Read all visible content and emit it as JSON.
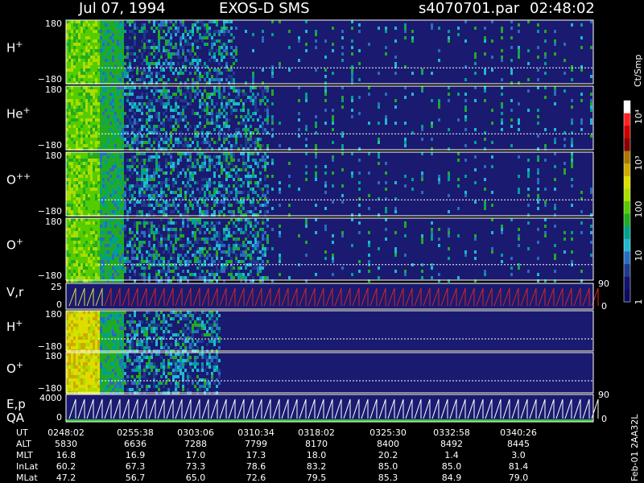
{
  "header": {
    "date": "Jul 07, 1994",
    "instrument": "EXOS-D SMS",
    "file": "s4070701.par",
    "time": "02:48:02"
  },
  "chart_data": {
    "type": "heatmap",
    "panels": [
      {
        "id": "h1",
        "label": "H",
        "sup": "+",
        "ytop": "180",
        "ybot": "−180",
        "ylim": [
          -180,
          180
        ],
        "kind": "spec",
        "rightlabel": ""
      },
      {
        "id": "he",
        "label": "He",
        "sup": "+",
        "ytop": "180",
        "ybot": "−180",
        "ylim": [
          -180,
          180
        ],
        "kind": "spec",
        "rightlabel": ""
      },
      {
        "id": "opp",
        "label": "O",
        "sup": "++",
        "ytop": "180",
        "ybot": "−180",
        "ylim": [
          -180,
          180
        ],
        "kind": "spec",
        "rightlabel": ""
      },
      {
        "id": "o1",
        "label": "O",
        "sup": "+",
        "ytop": "180",
        "ybot": "−180",
        "ylim": [
          -180,
          180
        ],
        "kind": "spec",
        "rightlabel": ""
      },
      {
        "id": "vr",
        "label": "V,r",
        "sup": "",
        "ytop": "25",
        "ybot": "0",
        "ylim": [
          0,
          25
        ],
        "kind": "saw",
        "rightlabel": "90",
        "rightlabel2": "0"
      },
      {
        "id": "h2",
        "label": "H",
        "sup": "+",
        "ytop": "180",
        "ybot": "−180",
        "ylim": [
          -180,
          180
        ],
        "kind": "spec2",
        "rightlabel": ""
      },
      {
        "id": "o2",
        "label": "O",
        "sup": "+",
        "ytop": "180",
        "ybot": "−180",
        "ylim": [
          -180,
          180
        ],
        "kind": "spec2",
        "rightlabel": ""
      },
      {
        "id": "ep",
        "label": "E,p",
        "sup": "",
        "label2": "QA",
        "ytop": "4000",
        "ybot": "0",
        "ylim": [
          0,
          4000
        ],
        "kind": "saw2",
        "rightlabel": "90",
        "rightlabel2": "0"
      }
    ],
    "colorbar": {
      "title": "Ct/Smp",
      "ticks": [
        "10",
        "4",
        "10",
        "3",
        "100",
        "10",
        "1"
      ],
      "tick_labels": [
        "10⁴",
        "10³",
        "100",
        "10",
        "1"
      ],
      "scale": "log",
      "range": [
        1,
        10000
      ],
      "colors": [
        "#0c0c5e",
        "#13136e",
        "#1f3a8a",
        "#2a6cc0",
        "#20b8d0",
        "#00a090",
        "#22aa22",
        "#55cc00",
        "#aadd00",
        "#dddd00",
        "#ccaa00",
        "#aa7700",
        "#880000",
        "#cc0000",
        "#ff2222",
        "#ffffff"
      ]
    },
    "time_axis": {
      "row_labels": [
        "UT",
        "ALT",
        "MLT",
        "InLat",
        "MLat"
      ],
      "columns": [
        {
          "UT": "0248:02",
          "ALT": "5830",
          "MLT": "16.8",
          "InLat": "60.2",
          "MLat": "47.2"
        },
        {
          "UT": "0255:38",
          "ALT": "6636",
          "MLT": "16.9",
          "InLat": "67.3",
          "MLat": "56.7"
        },
        {
          "UT": "0303:06",
          "ALT": "7288",
          "MLT": "17.0",
          "InLat": "73.3",
          "MLat": "65.0"
        },
        {
          "UT": "0310:34",
          "ALT": "7799",
          "MLT": "17.3",
          "InLat": "78.6",
          "MLat": "72.6"
        },
        {
          "UT": "0318:02",
          "ALT": "8170",
          "MLT": "18.0",
          "InLat": "83.2",
          "MLat": "79.5"
        },
        {
          "UT": "0325:30",
          "ALT": "8400",
          "MLT": "20.2",
          "InLat": "85.0",
          "MLat": "85.3"
        },
        {
          "UT": "0332:58",
          "ALT": "8492",
          "MLT": "1.4",
          "InLat": "85.0",
          "MLat": "84.9"
        },
        {
          "UT": "0340:26",
          "ALT": "8445",
          "MLT": "3.0",
          "InLat": "81.4",
          "MLat": "79.0"
        }
      ]
    },
    "side_note": "Feb-01 2AA32L",
    "colors": {
      "background": "#000000",
      "panel_bg": "#1a1a70",
      "white": "#ffffff",
      "red": "#dd2222",
      "yellow": "#dddd44",
      "green": "#33cc33"
    }
  }
}
